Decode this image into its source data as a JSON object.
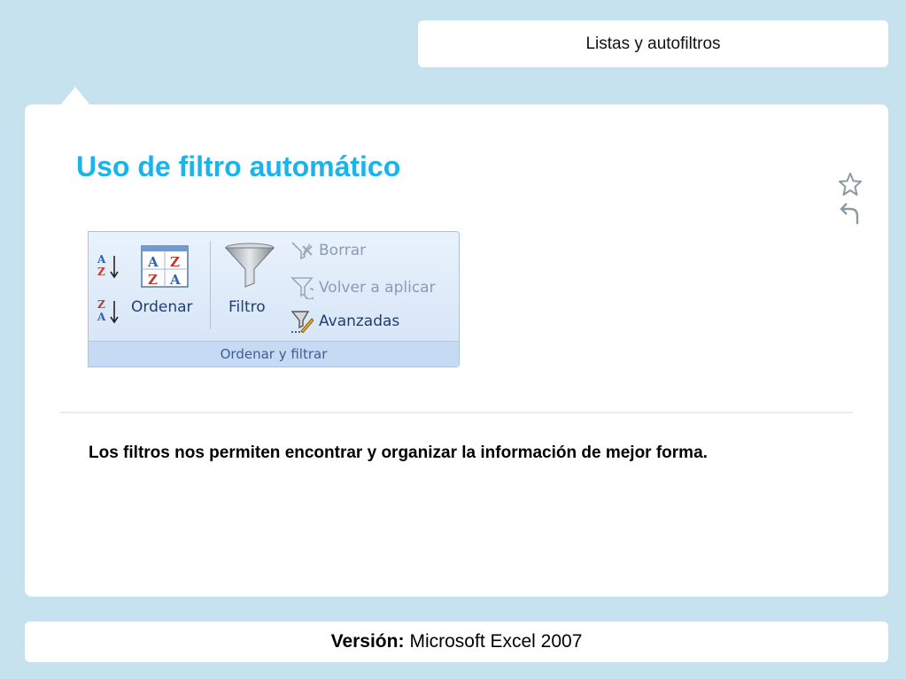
{
  "header": {
    "section_title": "Listas y autofiltros"
  },
  "slide": {
    "title": "Uso de filtro automático",
    "body": "Los filtros nos permiten encontrar y organizar la información de mejor forma.",
    "icons": [
      "star-icon",
      "undo-icon"
    ]
  },
  "ribbon": {
    "group_label": "Ordenar y filtrar",
    "sort_label": "Ordenar",
    "filter_label": "Filtro",
    "commands": [
      {
        "label": "Borrar",
        "enabled": false
      },
      {
        "label": "Volver a aplicar",
        "enabled": false
      },
      {
        "label": "Avanzadas",
        "enabled": true
      }
    ],
    "sort_icon_letters": {
      "a": "A",
      "z": "Z"
    }
  },
  "footer": {
    "version_label": "Versión:",
    "version_value": "Microsoft Excel 2007"
  },
  "colors": {
    "background": "#c6e2ef",
    "title": "#1bb3ec",
    "ribbon_text": "#1f3e73"
  }
}
